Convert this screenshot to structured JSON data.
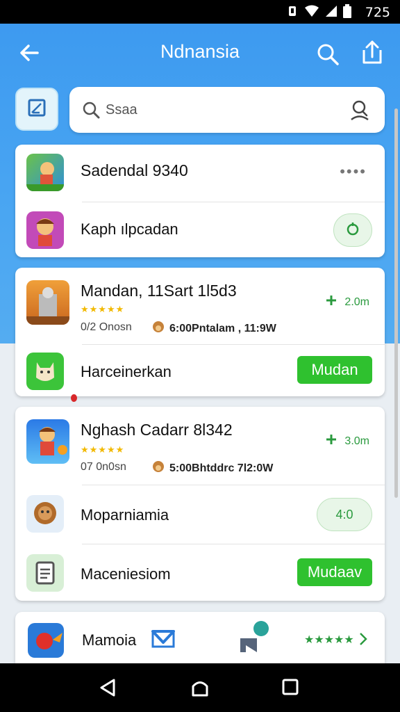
{
  "status_bar": {
    "time": "725"
  },
  "app_bar": {
    "title": "Ndnansia"
  },
  "search": {
    "placeholder": "Ssaa"
  },
  "cards": {
    "card1": {
      "row1": {
        "name": "Sadendal 9340",
        "more": "••••"
      },
      "row2": {
        "name": "Kaph ılpcadan"
      }
    },
    "card2": {
      "row1": {
        "name": "Mandan, 11Sart 1l5d3",
        "rating": "★★★★★",
        "size": "0/2 Onosn",
        "meta": "6:00Pntalam , 11:9W",
        "downloads": "2.0m"
      },
      "row2": {
        "name": "Harceinerkan",
        "button": "Mudan"
      }
    },
    "card3": {
      "row1": {
        "name": "Nghash Cadarr 8l342",
        "rating": "★★★★★",
        "size": "07 0n0sn",
        "meta": "5:00Bhtddrc 7l2:0W",
        "downloads": "3.0m"
      },
      "row2": {
        "name": "Moparniamia",
        "button": "4:0"
      },
      "row3": {
        "name": "Maceniesiom",
        "button": "Mudaav"
      }
    },
    "card4": {
      "name": "Mamoia",
      "stars": "★★★★★"
    }
  },
  "colors": {
    "appbar": "#3d9af0",
    "green": "#2fc12f",
    "star": "#f2b900"
  }
}
